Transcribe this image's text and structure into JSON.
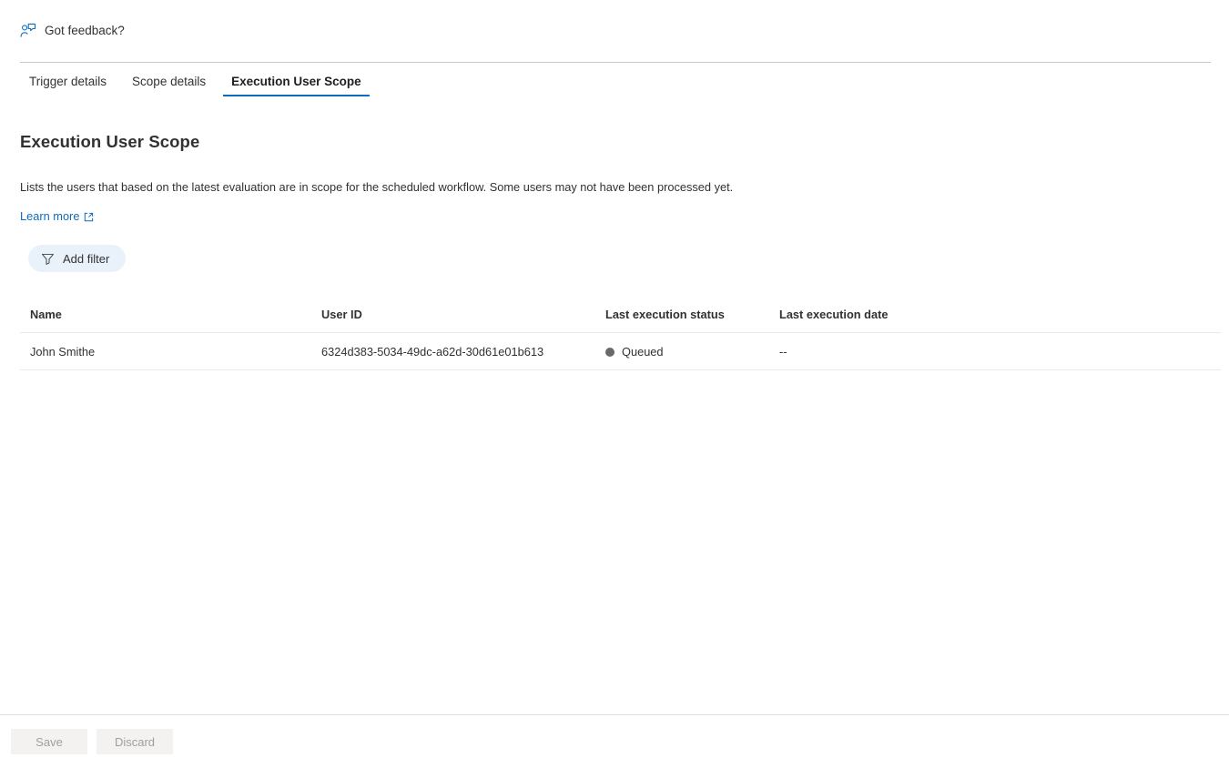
{
  "feedback": {
    "icon": "person-feedback-icon",
    "label": "Got feedback?"
  },
  "tabs": [
    {
      "label": "Trigger details",
      "active": false
    },
    {
      "label": "Scope details",
      "active": false
    },
    {
      "label": "Execution User Scope",
      "active": true
    }
  ],
  "page": {
    "title": "Execution User Scope",
    "description": "Lists the users that based on the latest evaluation are in scope for the scheduled workflow. Some users may not have been processed yet.",
    "learn_more": "Learn more",
    "learn_more_icon": "external-link-icon"
  },
  "toolbar": {
    "add_filter_label": "Add filter",
    "filter_icon": "funnel-icon"
  },
  "table": {
    "columns": [
      "Name",
      "User ID",
      "Last execution status",
      "Last execution date"
    ],
    "rows": [
      {
        "name": "John Smithe",
        "user_id": "6324d383-5034-49dc-a62d-30d61e01b613",
        "status": "Queued",
        "status_color": "#696969",
        "date": "--"
      }
    ]
  },
  "footer": {
    "save_label": "Save",
    "discard_label": "Discard"
  },
  "colors": {
    "accent": "#0f6cbd",
    "link": "#0f6cbd",
    "filter_pill": "#e9f2fb",
    "status_queued": "#696969",
    "divider": "#c8c6c4"
  }
}
